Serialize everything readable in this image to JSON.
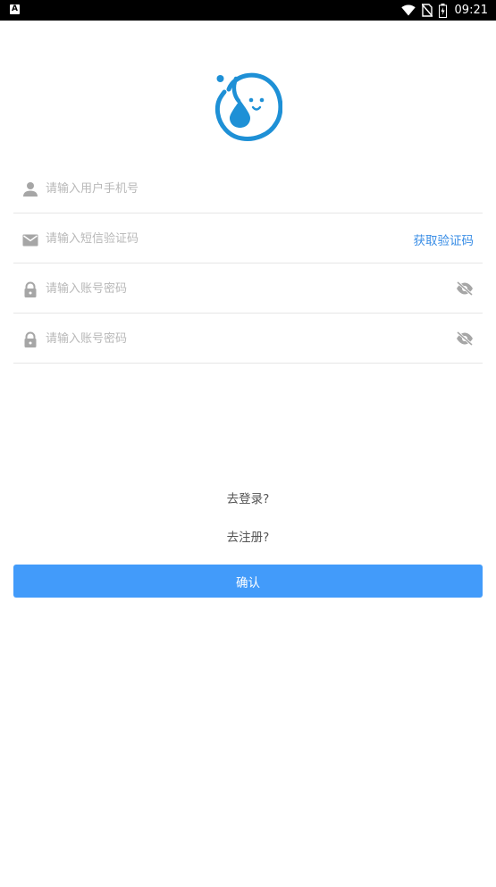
{
  "status_bar": {
    "left_badge": "A",
    "time": "09:21",
    "icons": [
      "wifi-icon",
      "no-sim-icon",
      "battery-icon"
    ]
  },
  "logo": {
    "icon": "water-drop-smile-logo",
    "color": "#1e90d6"
  },
  "form": {
    "phone": {
      "placeholder": "请输入用户手机号",
      "icon": "user-icon"
    },
    "sms": {
      "placeholder": "请输入短信验证码",
      "icon": "mail-icon",
      "action_label": "获取验证码"
    },
    "password": {
      "placeholder": "请输入账号密码",
      "icon": "lock-icon",
      "toggle_icon": "eye-off-icon"
    },
    "password_confirm": {
      "placeholder": "请输入账号密码",
      "icon": "lock-icon",
      "toggle_icon": "eye-off-icon"
    }
  },
  "links": {
    "login": "去登录?",
    "register": "去注册?"
  },
  "confirm_button": {
    "label": "确认"
  },
  "colors": {
    "accent": "#429bfa",
    "link_blue": "#3a8ee6",
    "placeholder": "#b8b8b8",
    "icon_gray": "#a6a6a6"
  }
}
